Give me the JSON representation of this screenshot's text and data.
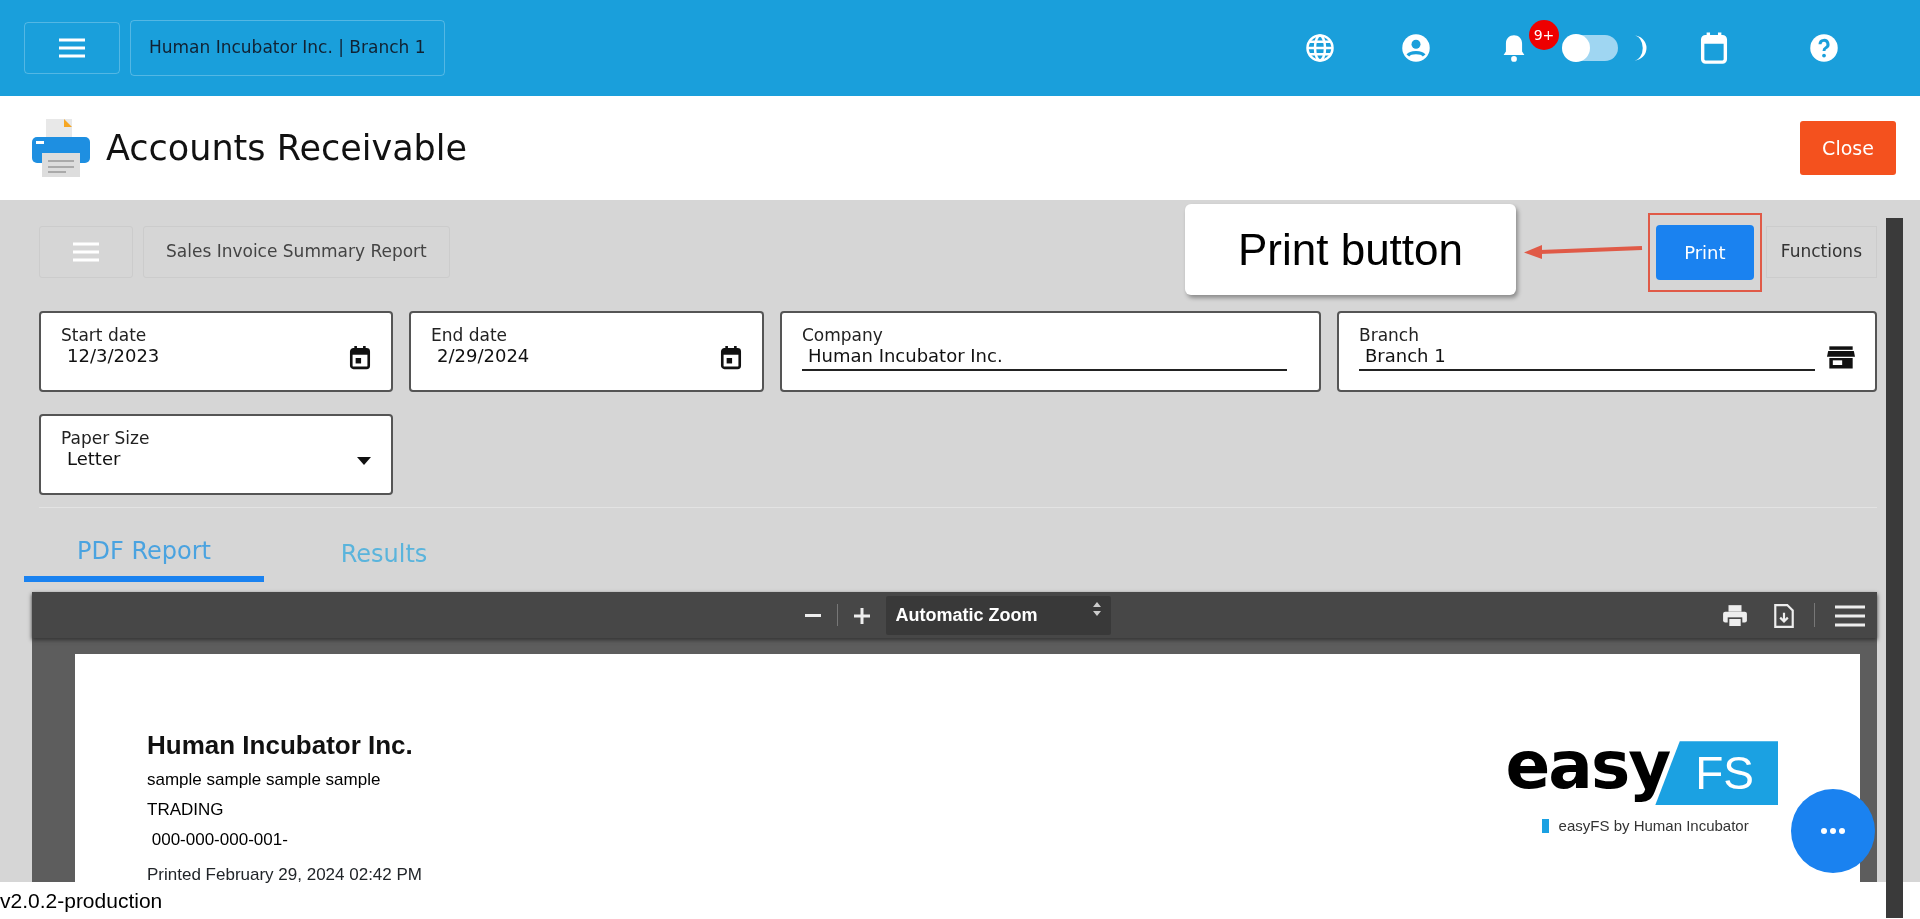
{
  "topbar": {
    "org_label": "Human Incubator Inc. | Branch 1",
    "notification_badge": "9+",
    "dark_mode": false
  },
  "header": {
    "title": "Accounts Receivable",
    "close_button": "Close"
  },
  "report_toolbar": {
    "title": "Sales Invoice Summary Report",
    "print_button": "Print",
    "functions_button": "Functions"
  },
  "callout": {
    "text": "Print button"
  },
  "fields": [
    {
      "kind": "date",
      "label": "Start date",
      "value": "12/3/2023"
    },
    {
      "kind": "date",
      "label": "End date",
      "value": "2/29/2024"
    },
    {
      "kind": "text",
      "label": "Company",
      "value": "Human Incubator Inc."
    },
    {
      "kind": "store",
      "label": "Branch",
      "value": "Branch 1"
    },
    {
      "kind": "select",
      "label": "Paper Size",
      "value": "Letter"
    }
  ],
  "tabs": [
    {
      "label": "PDF Report",
      "selected": true
    },
    {
      "label": "Results",
      "selected": false
    }
  ],
  "pdf_viewer": {
    "zoom_select": "Automatic Zoom",
    "document": {
      "company": "Human Incubator Inc.",
      "lines": [
        "sample sample sample sample",
        "TRADING",
        " 000-000-000-001-"
      ],
      "printed": "Printed February 29, 2024 02:42 PM",
      "logo": {
        "word": "easy",
        "tag": "FS",
        "caption": "easyFS by Human Incubator"
      }
    }
  },
  "footer": {
    "version": "v2.0.2-production"
  }
}
